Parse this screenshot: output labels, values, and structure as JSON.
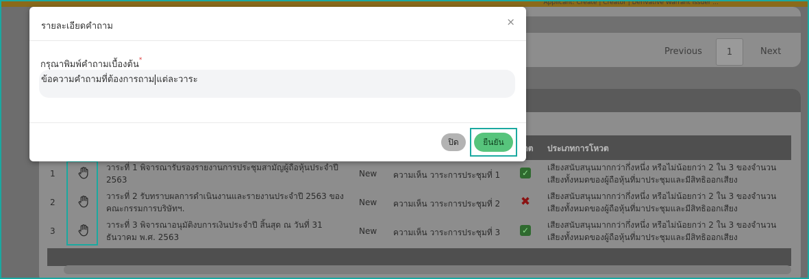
{
  "background": {
    "header_strip_text": "Applicant: Create | Creator | Derivative Warrant Issuer ...",
    "pagination": {
      "previous": "Previous",
      "page": "1",
      "next": "Next"
    },
    "table": {
      "headers": {
        "vote_partial": "ตต",
        "method": "ประเภทการโหวต"
      },
      "rows": [
        {
          "no": "1",
          "agenda": "วาระที่ 1 พิจารณารับรองรายงานการประชุมสามัญผู้ถือหุ้นประจำปี 2563",
          "status": "New",
          "comment": "ความเห็น วาระการประชุมที่ 1",
          "vote": "approve",
          "method": "เสียงสนับสนุนมากกว่ากึ่งหนึ่ง หรือไม่น้อยกว่า 2 ใน 3 ของจำนวนเสียงทั้งหมดของผู้ถือหุ้นที่มาประชุมและมีสิทธิออกเสียง"
        },
        {
          "no": "2",
          "agenda": "วาระที่ 2 รับทราบผลการดำเนินงานและรายงานประจำปี 2563 ของคณะกรรมการบริษัทฯ.",
          "status": "New",
          "comment": "ความเห็น วาระการประชุมที่ 2",
          "vote": "reject",
          "method": "เสียงสนับสนุนมากกว่ากึ่งหนึ่ง หรือไม่น้อยกว่า 2 ใน 3 ของจำนวนเสียงทั้งหมดของผู้ถือหุ้นที่มาประชุมและมีสิทธิออกเสียง"
        },
        {
          "no": "3",
          "agenda": "วาระที่ 3 พิจารณาอนุมัติงบการเงินประจำปี สิ้นสุด ณ วันที่ 31 ธันวาคม พ.ศ. 2563",
          "status": "New",
          "comment": "ความเห็น วาระการประชุมที่ 3",
          "vote": "approve",
          "method": "เสียงสนับสนุนมากกว่ากึ่งหนึ่ง หรือไม่น้อยกว่า 2 ใน 3 ของจำนวนเสียงทั้งหมดของผู้ถือหุ้นที่มาประชุมและมีสิทธิออกเสียง"
        }
      ]
    }
  },
  "modal": {
    "title": "รายละเอียดคำถาม",
    "close_icon": "×",
    "field_label": "กรุณาพิมพ์คำถามเบื้องต้น",
    "required_mark": "*",
    "question_before_caret": "ข้อความคำถามที่ต้องการถาม",
    "question_after_caret": "แต่ละวาระ",
    "buttons": {
      "close": "ปิด",
      "confirm": "ยืนยัน"
    }
  },
  "icons": {
    "raise_hand": "hand-raise-icon",
    "approve": "check-icon",
    "reject": "cross-icon"
  },
  "colors": {
    "accent": "#1aa9a0",
    "confirm": "#57c47c",
    "approve": "#2f6a2f",
    "reject": "#8a1212"
  }
}
